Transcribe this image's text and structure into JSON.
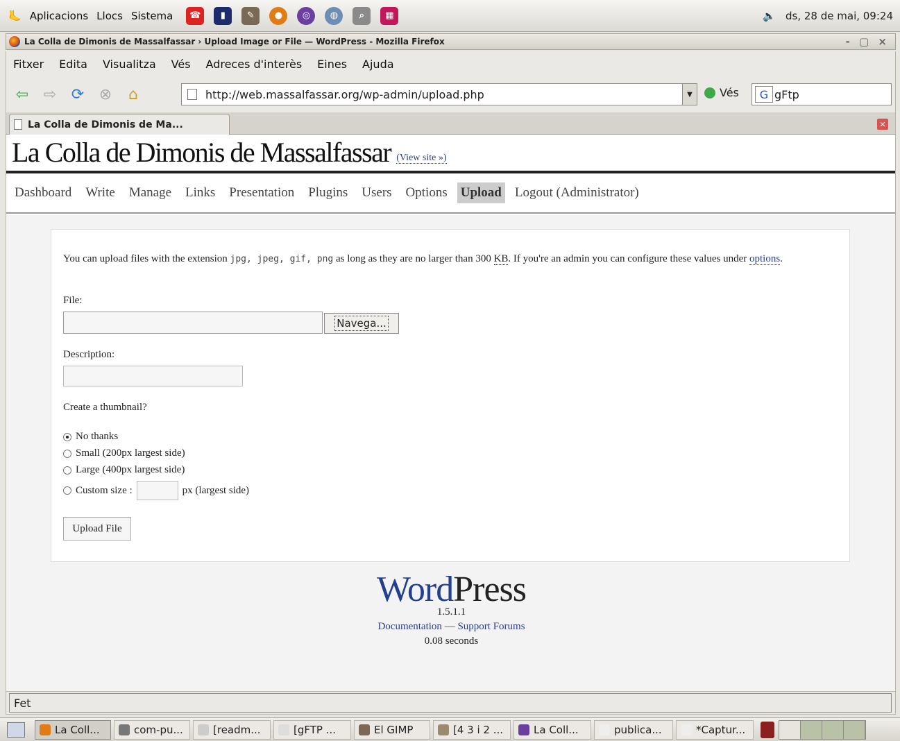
{
  "top_panel": {
    "menus": [
      "Aplicacions",
      "Llocs",
      "Sistema"
    ],
    "clock": "ds, 28 de mai, 09:24",
    "launcher_icons": [
      "phone-icon",
      "terminal-icon",
      "gimp-icon",
      "firefox-icon",
      "gftp-icon",
      "network-icon",
      "search-icon",
      "calendar-icon"
    ]
  },
  "window": {
    "title": "La Colla de Dimonis de Massalfassar › Upload Image or File — WordPress - Mozilla Firefox",
    "controls": "- ▢ ×"
  },
  "menubar": [
    "Fitxer",
    "Edita",
    "Visualitza",
    "Vés",
    "Adreces d'interès",
    "Eines",
    "Ajuda"
  ],
  "navbar": {
    "url": "http://web.massalfassar.org/wp-admin/upload.php",
    "go_label": "Vés",
    "search_value": "gFtp"
  },
  "tab": {
    "label": "La Colla de Dimonis de Ma..."
  },
  "wp": {
    "site_title": "La Colla de Dimonis de Massalfassar",
    "view_site": "(View site »)",
    "nav": [
      "Dashboard",
      "Write",
      "Manage",
      "Links",
      "Presentation",
      "Plugins",
      "Users",
      "Options",
      "Upload",
      "Logout (Administrator)"
    ],
    "current_nav": "Upload",
    "intro_before": "You can upload files with the extension ",
    "extensions": "jpg, jpeg, gif, png",
    "intro_mid": " as long as they are no larger than 300 ",
    "kb": "KB",
    "intro_after": ". If you're an admin you can configure these values under ",
    "options_link": "options",
    "intro_end": ".",
    "file_label": "File:",
    "browse_label": "Navega...",
    "description_label": "Description:",
    "thumbnail_label": "Create a thumbnail?",
    "thumb_options": [
      "No thanks",
      "Small (200px largest side)",
      "Large (400px largest side)",
      "Custom size :"
    ],
    "custom_suffix": "px (largest side)",
    "upload_button": "Upload File",
    "logo_word": "Word",
    "logo_press": "Press",
    "version": "1.5.1.1",
    "documentation_link": "Documentation",
    "separator": " — ",
    "support_link": "Support Forums",
    "timing": "0.08 seconds"
  },
  "status": "Fet",
  "taskbar": [
    "La Coll...",
    "com-pu...",
    "[readm...",
    "[gFTP ...",
    "El GIMP",
    "[4 3 i 2 ...",
    "La Coll...",
    "publica...",
    "*Captur..."
  ]
}
